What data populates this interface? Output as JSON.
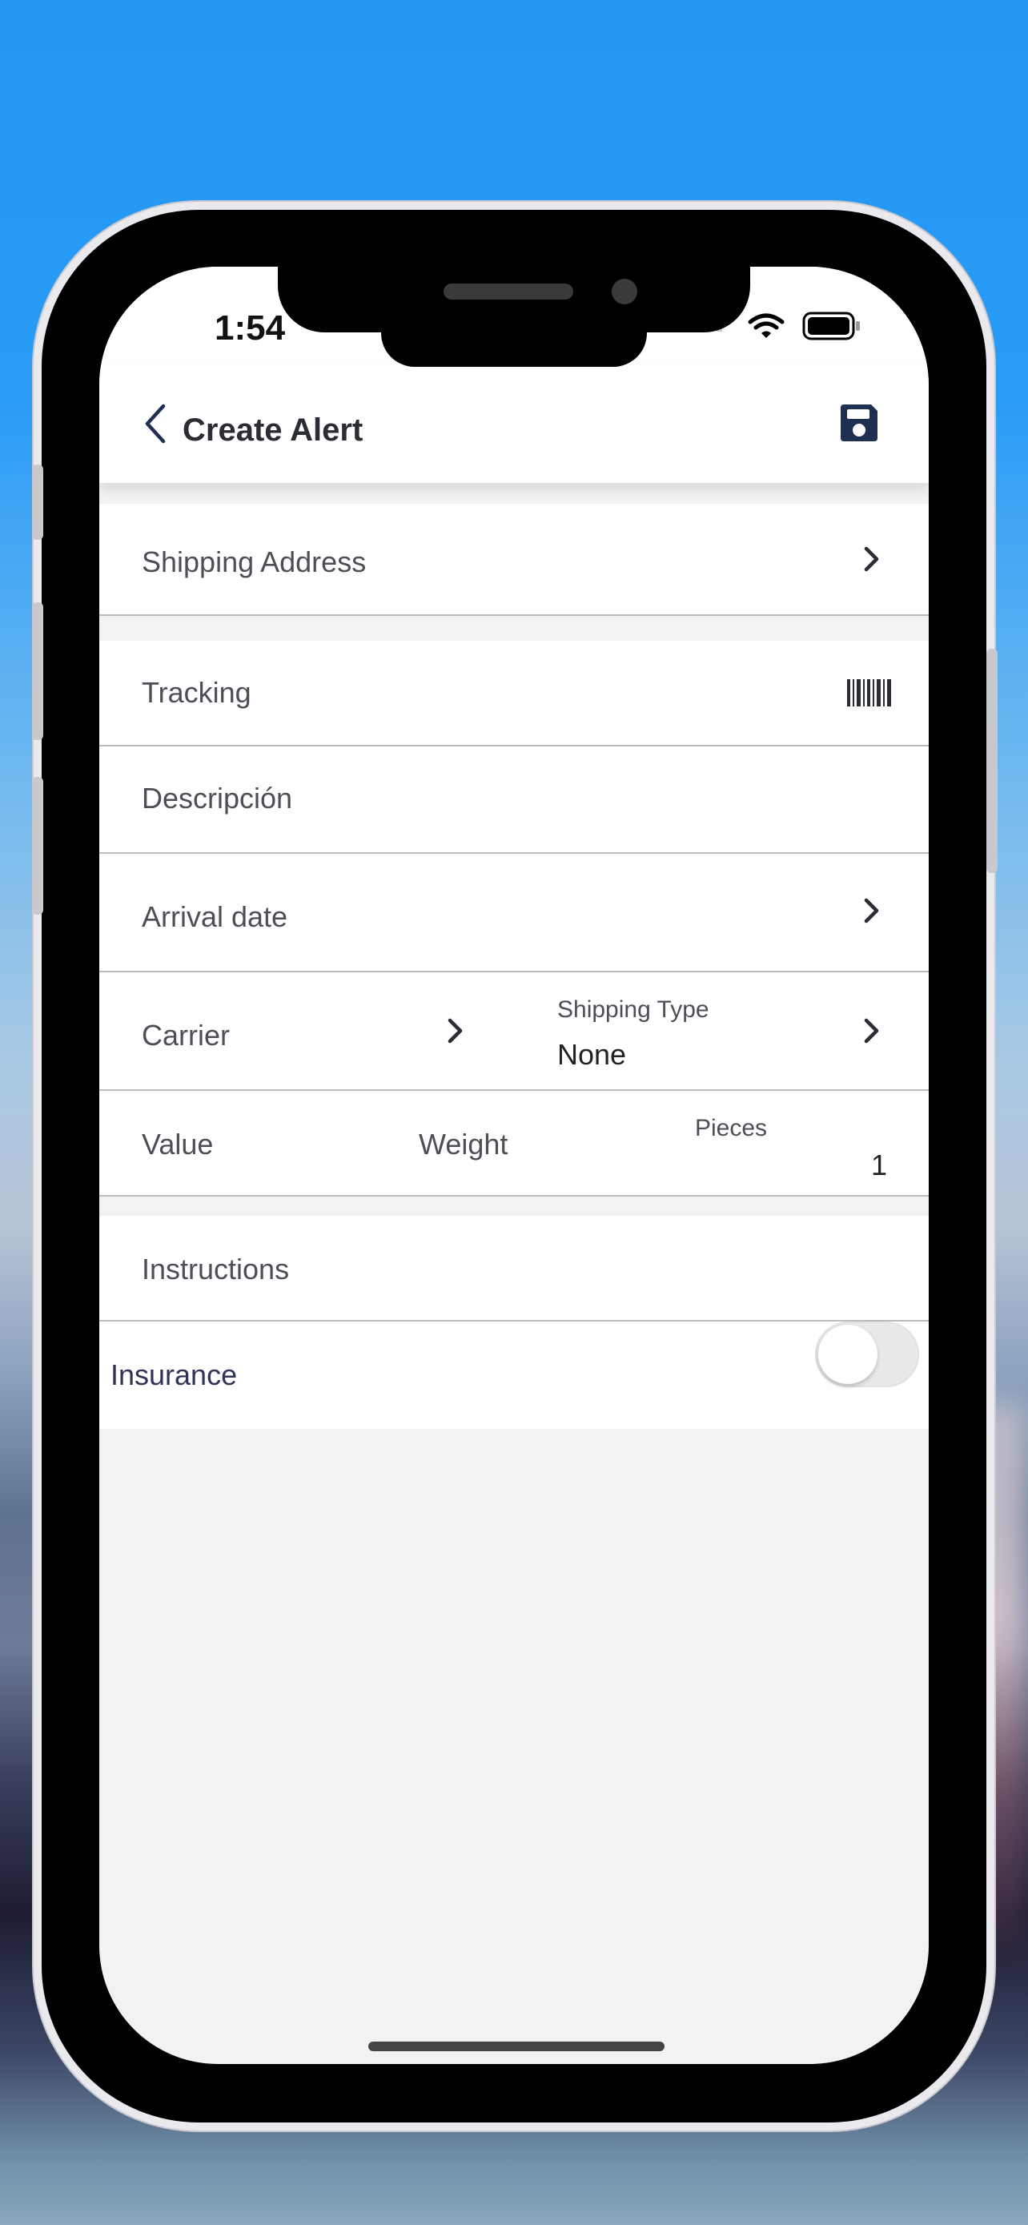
{
  "status_bar": {
    "time": "1:54"
  },
  "header": {
    "title": "Create Alert"
  },
  "form": {
    "shipping_address": "Shipping Address",
    "tracking": "Tracking",
    "description": "Descripción",
    "arrival_date": "Arrival date",
    "carrier": "Carrier",
    "shipping_type_label": "Shipping Type",
    "shipping_type_value": "None",
    "value": "Value",
    "weight": "Weight",
    "pieces_label": "Pieces",
    "pieces_value": "1",
    "instructions": "Instructions",
    "insurance": "Insurance",
    "insurance_on": false
  },
  "colors": {
    "accent": "#1f2f52",
    "text": "#4d4f57"
  }
}
